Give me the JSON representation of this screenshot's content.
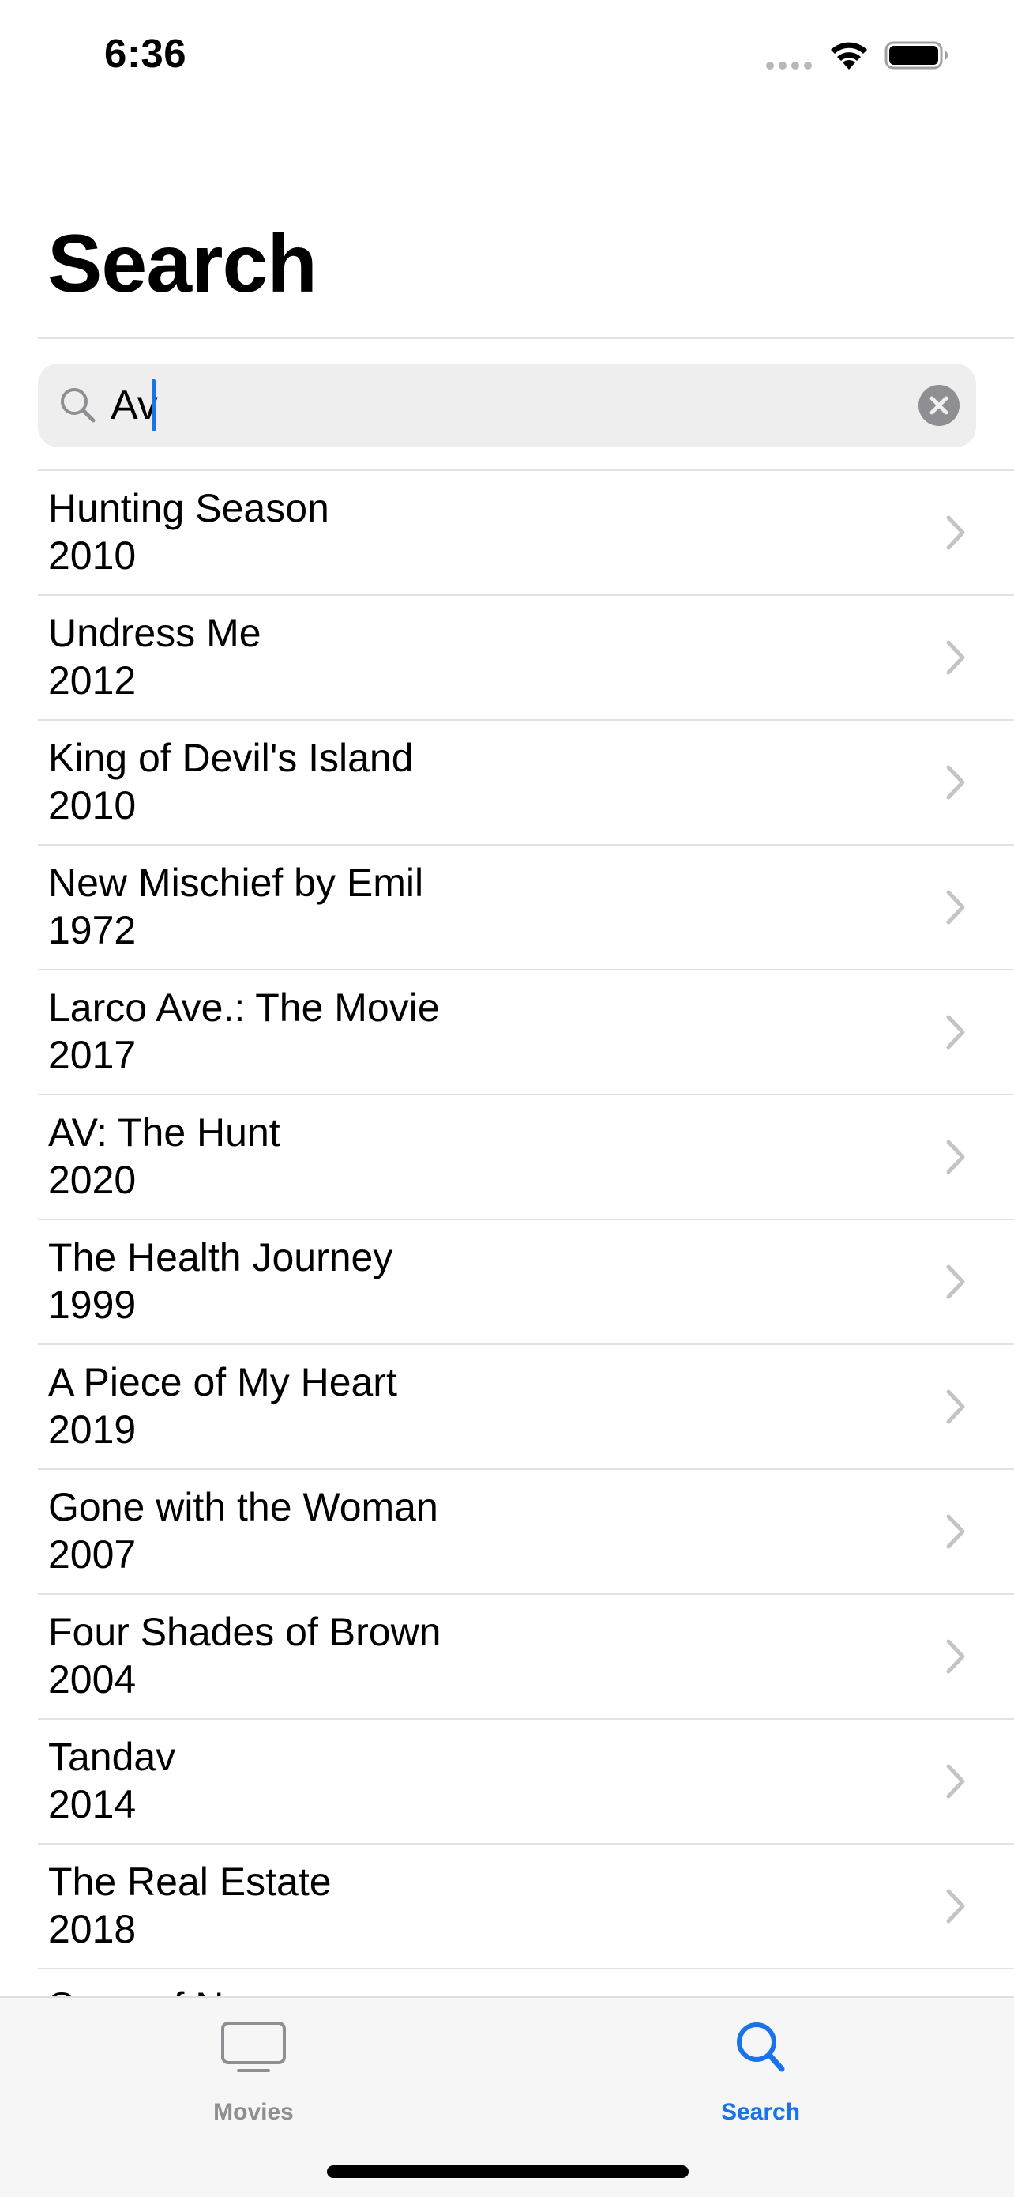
{
  "status_bar": {
    "time": "6:36"
  },
  "header": {
    "title": "Search"
  },
  "search": {
    "value": "Av",
    "placeholder": ""
  },
  "results": [
    {
      "title": "Hunting Season",
      "year": "2010"
    },
    {
      "title": "Undress Me",
      "year": "2012"
    },
    {
      "title": "King of Devil's Island",
      "year": "2010"
    },
    {
      "title": "New Mischief by Emil",
      "year": "1972"
    },
    {
      "title": "Larco Ave.: The Movie",
      "year": "2017"
    },
    {
      "title": "AV: The Hunt",
      "year": "2020"
    },
    {
      "title": "The Health Journey",
      "year": "1999"
    },
    {
      "title": "A Piece of My Heart",
      "year": "2019"
    },
    {
      "title": "Gone with the Woman",
      "year": "2007"
    },
    {
      "title": "Four Shades of Brown",
      "year": "2004"
    },
    {
      "title": "Tandav",
      "year": "2014"
    },
    {
      "title": "The Real Estate",
      "year": "2018"
    },
    {
      "title": "Song of N",
      "year": ""
    }
  ],
  "tab_bar": {
    "tabs": [
      {
        "label": "Movies",
        "icon": "tv-icon",
        "selected": false
      },
      {
        "label": "Search",
        "icon": "magnifier-icon",
        "selected": true
      }
    ]
  },
  "colors": {
    "accent": "#1a73e8",
    "inactive": "#8e8e93",
    "separator": "#e3e3e6",
    "chevron": "#c4c4c7"
  }
}
